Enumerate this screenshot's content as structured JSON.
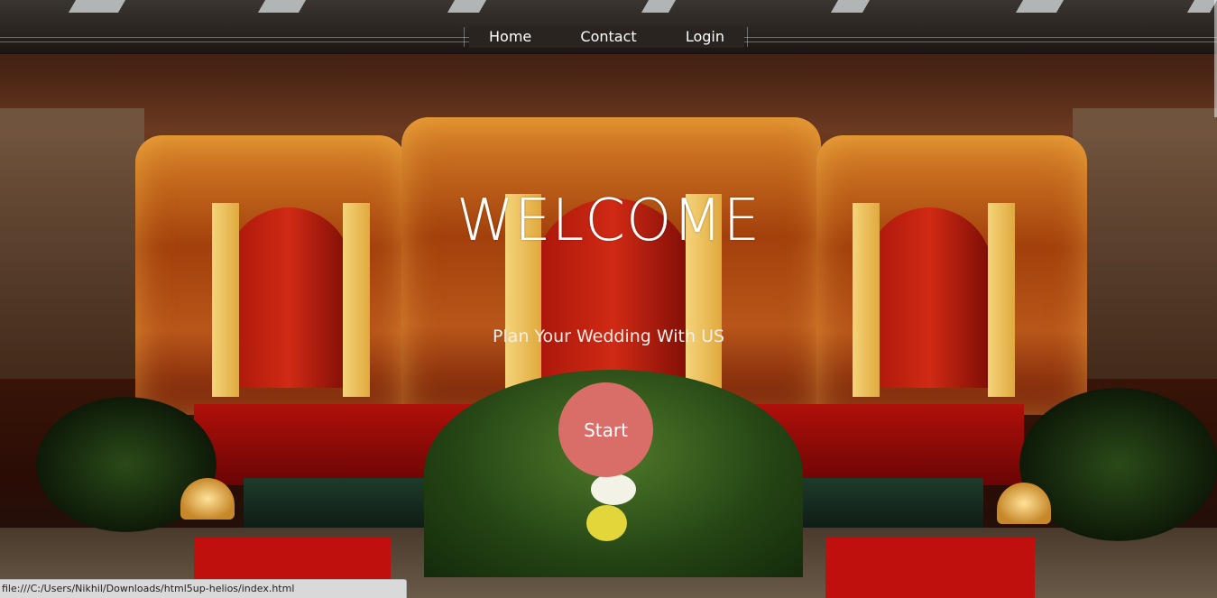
{
  "nav": {
    "items": [
      {
        "label": "Home"
      },
      {
        "label": "Contact"
      },
      {
        "label": "Login"
      }
    ]
  },
  "hero": {
    "title": "WELCOME",
    "subtitle": "Plan Your Wedding With US",
    "start_label": "Start"
  },
  "statusbar": {
    "url": "file:///C:/Users/Nikhil/Downloads/html5up-helios/index.html"
  },
  "colors": {
    "start_button": "#d96e68",
    "nav_text": "#ffffff",
    "hero_text": "#ffffff"
  }
}
